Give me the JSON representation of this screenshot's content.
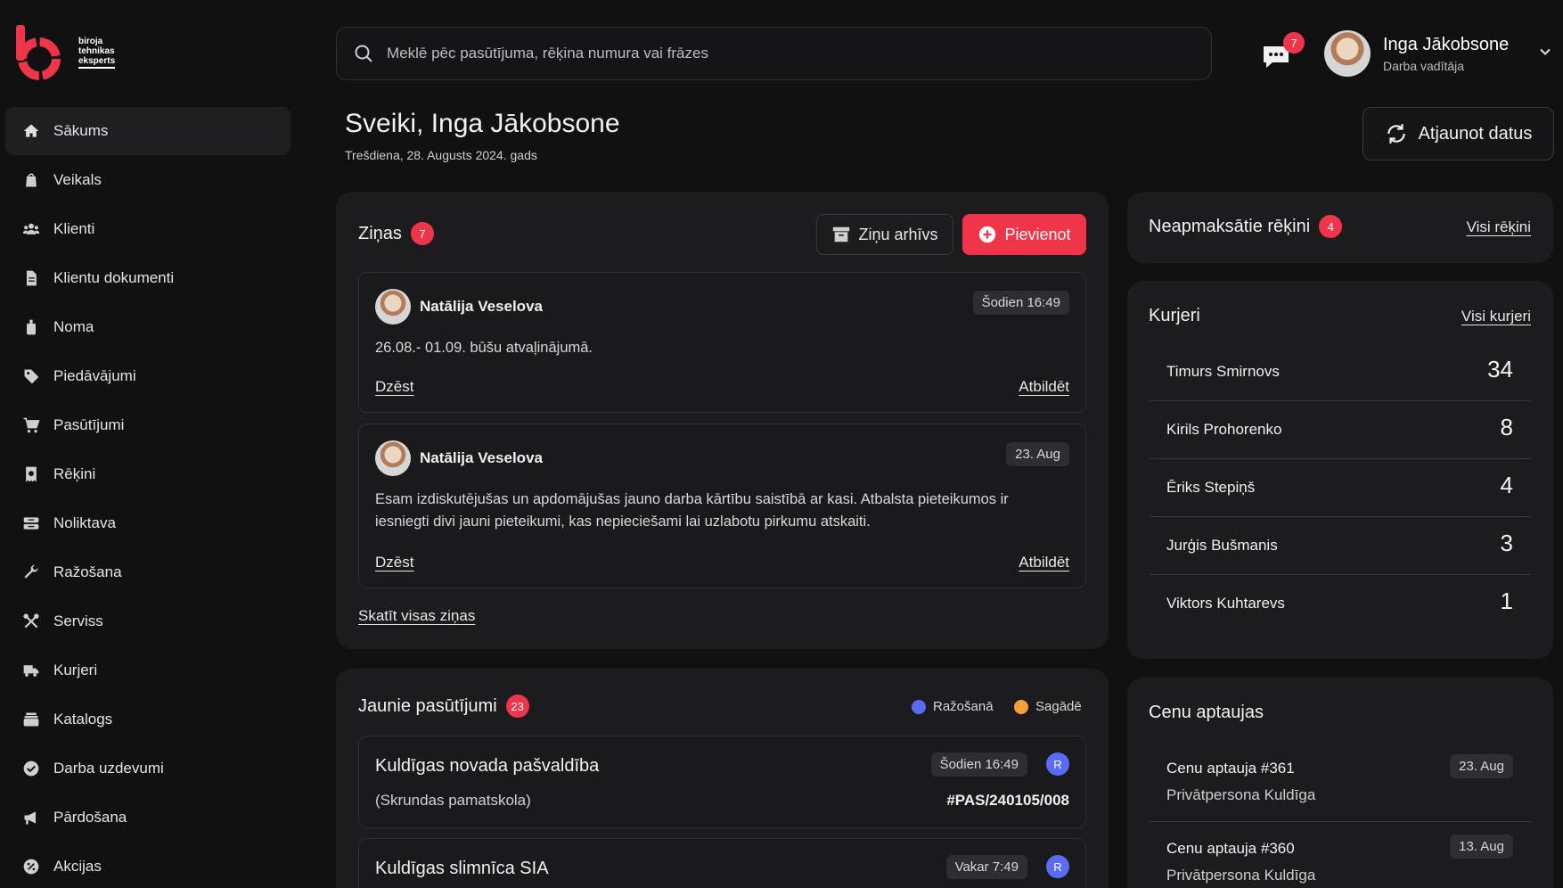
{
  "brand": {
    "line1": "biroja",
    "line2": "tehnikas",
    "line3": "eksperts",
    "accent": "#f0354b"
  },
  "search": {
    "placeholder": "Meklē pēc pasūtījuma, rēķina numura vai frāzes"
  },
  "header": {
    "chat_count": "7",
    "user_name": "Inga Jākobsone",
    "user_role": "Darba vadītāja"
  },
  "nav": [
    {
      "label": "Sākums",
      "icon": "home-icon",
      "active": true
    },
    {
      "label": "Veikals",
      "icon": "shopping-bag-icon"
    },
    {
      "label": "Klienti",
      "icon": "users-icon"
    },
    {
      "label": "Klientu dokumenti",
      "icon": "document-icon"
    },
    {
      "label": "Noma",
      "icon": "bag-icon"
    },
    {
      "label": "Piedāvājumi",
      "icon": "tag-icon"
    },
    {
      "label": "Pasūtījumi",
      "icon": "cart-icon"
    },
    {
      "label": "Rēķini",
      "icon": "invoice-icon"
    },
    {
      "label": "Noliktava",
      "icon": "warehouse-icon"
    },
    {
      "label": "Ražošana",
      "icon": "wrench-icon"
    },
    {
      "label": "Serviss",
      "icon": "tools-icon"
    },
    {
      "label": "Kurjeri",
      "icon": "truck-icon"
    },
    {
      "label": "Katalogs",
      "icon": "catalog-icon"
    },
    {
      "label": "Darba uzdevumi",
      "icon": "check-circle-icon"
    },
    {
      "label": "Pārdošana",
      "icon": "megaphone-icon"
    },
    {
      "label": "Akcijas",
      "icon": "percent-icon"
    }
  ],
  "greeting": {
    "title": "Sveiki, Inga Jākobsone",
    "date": "Trešdiena, 28. Augusts 2024. gads",
    "refresh_label": "Atjaunot datus"
  },
  "news": {
    "title": "Ziņas",
    "count": "7",
    "archive_label": "Ziņu arhīvs",
    "add_label": "Pievienot",
    "view_all": "Skatīt visas ziņas",
    "messages": [
      {
        "author": "Natālija Veselova",
        "time": "Šodien 16:49",
        "text": "26.08.- 01.09. būšu atvaļinājumā.",
        "delete": "Dzēst",
        "reply": "Atbildēt"
      },
      {
        "author": "Natālija Veselova",
        "time": "23. Aug",
        "text": "Esam izdiskutējušas un apdomājušas jauno darba kārtību saistībā ar kasi. Atbalsta pieteikumos ir iesniegti divi jauni pieteikumi, kas nepieciešami lai uzlabotu pirkumu atskaiti.",
        "delete": "Dzēst",
        "reply": "Atbildēt"
      }
    ]
  },
  "orders": {
    "title": "Jaunie pasūtījumi",
    "count": "23",
    "legend": [
      {
        "label": "Ražošanā",
        "color": "#5a6cf5"
      },
      {
        "label": "Sagādē",
        "color": "#f59f3a"
      }
    ],
    "items": [
      {
        "name": "Kuldīgas novada pašvaldība",
        "sub": "(Skrundas pamatskola)",
        "time": "Šodien 16:49",
        "badge": "R",
        "number": "#PAS/240105/008"
      },
      {
        "name": "Kuldīgas slimnīca SIA",
        "sub": "",
        "time": "Vakar 7:49",
        "badge": "R",
        "number": ""
      }
    ]
  },
  "invoices": {
    "title": "Neapmaksātie rēķini",
    "count": "4",
    "link": "Visi rēķini"
  },
  "couriers": {
    "title": "Kurjeri",
    "link": "Visi kurjeri",
    "items": [
      {
        "name": "Timurs Smirnovs",
        "count": "34"
      },
      {
        "name": "Kirils Prohorenko",
        "count": "8"
      },
      {
        "name": "Ēriks Stepiņš",
        "count": "4"
      },
      {
        "name": "Jurģis Bušmanis",
        "count": "3"
      },
      {
        "name": "Viktors Kuhtarevs",
        "count": "1"
      }
    ]
  },
  "surveys": {
    "title": "Cenu aptaujas",
    "items": [
      {
        "title": "Cenu aptauja #361",
        "sub": "Privātpersona Kuldīga",
        "date": "23. Aug"
      },
      {
        "title": "Cenu aptauja #360",
        "sub": "Privātpersona Kuldīga",
        "date": "13. Aug"
      }
    ]
  }
}
